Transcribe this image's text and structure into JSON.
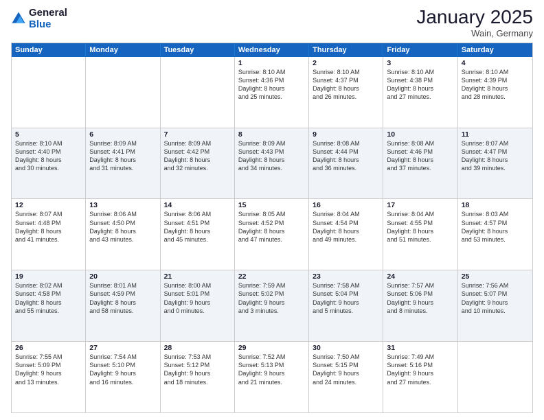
{
  "header": {
    "logo_line1": "General",
    "logo_line2": "Blue",
    "title": "January 2025",
    "subtitle": "Wain, Germany"
  },
  "weekdays": [
    "Sunday",
    "Monday",
    "Tuesday",
    "Wednesday",
    "Thursday",
    "Friday",
    "Saturday"
  ],
  "rows": [
    [
      {
        "day": "",
        "text": ""
      },
      {
        "day": "",
        "text": ""
      },
      {
        "day": "",
        "text": ""
      },
      {
        "day": "1",
        "text": "Sunrise: 8:10 AM\nSunset: 4:36 PM\nDaylight: 8 hours\nand 25 minutes."
      },
      {
        "day": "2",
        "text": "Sunrise: 8:10 AM\nSunset: 4:37 PM\nDaylight: 8 hours\nand 26 minutes."
      },
      {
        "day": "3",
        "text": "Sunrise: 8:10 AM\nSunset: 4:38 PM\nDaylight: 8 hours\nand 27 minutes."
      },
      {
        "day": "4",
        "text": "Sunrise: 8:10 AM\nSunset: 4:39 PM\nDaylight: 8 hours\nand 28 minutes."
      }
    ],
    [
      {
        "day": "5",
        "text": "Sunrise: 8:10 AM\nSunset: 4:40 PM\nDaylight: 8 hours\nand 30 minutes."
      },
      {
        "day": "6",
        "text": "Sunrise: 8:09 AM\nSunset: 4:41 PM\nDaylight: 8 hours\nand 31 minutes."
      },
      {
        "day": "7",
        "text": "Sunrise: 8:09 AM\nSunset: 4:42 PM\nDaylight: 8 hours\nand 32 minutes."
      },
      {
        "day": "8",
        "text": "Sunrise: 8:09 AM\nSunset: 4:43 PM\nDaylight: 8 hours\nand 34 minutes."
      },
      {
        "day": "9",
        "text": "Sunrise: 8:08 AM\nSunset: 4:44 PM\nDaylight: 8 hours\nand 36 minutes."
      },
      {
        "day": "10",
        "text": "Sunrise: 8:08 AM\nSunset: 4:46 PM\nDaylight: 8 hours\nand 37 minutes."
      },
      {
        "day": "11",
        "text": "Sunrise: 8:07 AM\nSunset: 4:47 PM\nDaylight: 8 hours\nand 39 minutes."
      }
    ],
    [
      {
        "day": "12",
        "text": "Sunrise: 8:07 AM\nSunset: 4:48 PM\nDaylight: 8 hours\nand 41 minutes."
      },
      {
        "day": "13",
        "text": "Sunrise: 8:06 AM\nSunset: 4:50 PM\nDaylight: 8 hours\nand 43 minutes."
      },
      {
        "day": "14",
        "text": "Sunrise: 8:06 AM\nSunset: 4:51 PM\nDaylight: 8 hours\nand 45 minutes."
      },
      {
        "day": "15",
        "text": "Sunrise: 8:05 AM\nSunset: 4:52 PM\nDaylight: 8 hours\nand 47 minutes."
      },
      {
        "day": "16",
        "text": "Sunrise: 8:04 AM\nSunset: 4:54 PM\nDaylight: 8 hours\nand 49 minutes."
      },
      {
        "day": "17",
        "text": "Sunrise: 8:04 AM\nSunset: 4:55 PM\nDaylight: 8 hours\nand 51 minutes."
      },
      {
        "day": "18",
        "text": "Sunrise: 8:03 AM\nSunset: 4:57 PM\nDaylight: 8 hours\nand 53 minutes."
      }
    ],
    [
      {
        "day": "19",
        "text": "Sunrise: 8:02 AM\nSunset: 4:58 PM\nDaylight: 8 hours\nand 55 minutes."
      },
      {
        "day": "20",
        "text": "Sunrise: 8:01 AM\nSunset: 4:59 PM\nDaylight: 8 hours\nand 58 minutes."
      },
      {
        "day": "21",
        "text": "Sunrise: 8:00 AM\nSunset: 5:01 PM\nDaylight: 9 hours\nand 0 minutes."
      },
      {
        "day": "22",
        "text": "Sunrise: 7:59 AM\nSunset: 5:02 PM\nDaylight: 9 hours\nand 3 minutes."
      },
      {
        "day": "23",
        "text": "Sunrise: 7:58 AM\nSunset: 5:04 PM\nDaylight: 9 hours\nand 5 minutes."
      },
      {
        "day": "24",
        "text": "Sunrise: 7:57 AM\nSunset: 5:06 PM\nDaylight: 9 hours\nand 8 minutes."
      },
      {
        "day": "25",
        "text": "Sunrise: 7:56 AM\nSunset: 5:07 PM\nDaylight: 9 hours\nand 10 minutes."
      }
    ],
    [
      {
        "day": "26",
        "text": "Sunrise: 7:55 AM\nSunset: 5:09 PM\nDaylight: 9 hours\nand 13 minutes."
      },
      {
        "day": "27",
        "text": "Sunrise: 7:54 AM\nSunset: 5:10 PM\nDaylight: 9 hours\nand 16 minutes."
      },
      {
        "day": "28",
        "text": "Sunrise: 7:53 AM\nSunset: 5:12 PM\nDaylight: 9 hours\nand 18 minutes."
      },
      {
        "day": "29",
        "text": "Sunrise: 7:52 AM\nSunset: 5:13 PM\nDaylight: 9 hours\nand 21 minutes."
      },
      {
        "day": "30",
        "text": "Sunrise: 7:50 AM\nSunset: 5:15 PM\nDaylight: 9 hours\nand 24 minutes."
      },
      {
        "day": "31",
        "text": "Sunrise: 7:49 AM\nSunset: 5:16 PM\nDaylight: 9 hours\nand 27 minutes."
      },
      {
        "day": "",
        "text": ""
      }
    ]
  ]
}
